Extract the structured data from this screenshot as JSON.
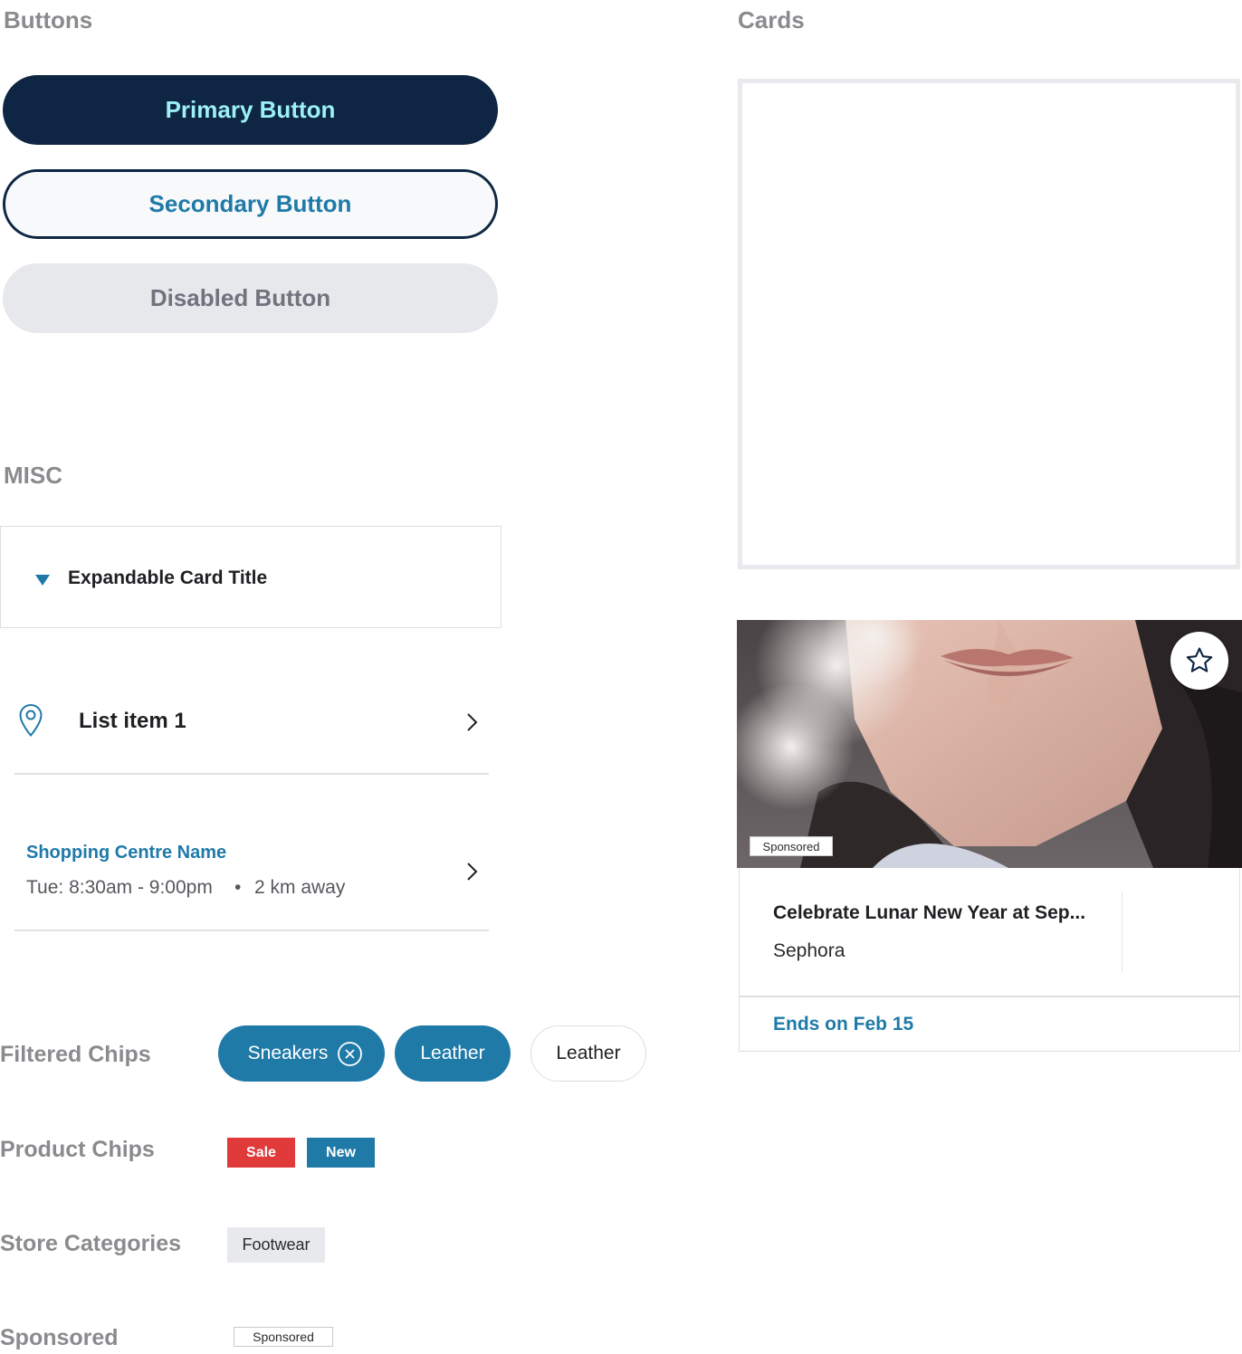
{
  "sections": {
    "buttons": "Buttons",
    "cards": "Cards",
    "misc": "MISC"
  },
  "buttons": {
    "primary": "Primary Button",
    "secondary": "Secondary Button",
    "disabled": "Disabled Button"
  },
  "expandable_card": {
    "title": "Expandable Card Title"
  },
  "list_item": {
    "label": "List item 1",
    "icon": "map-pin-icon"
  },
  "shopping_centre": {
    "name": "Shopping Centre Name",
    "hours": "Tue: 8:30am - 9:00pm",
    "separator": "•",
    "distance": "2 km away"
  },
  "filtered_chips": {
    "label": "Filtered Chips",
    "chips": [
      "Sneakers",
      "Leather",
      "Leather"
    ]
  },
  "product_chips": {
    "label": "Product Chips",
    "sale": "Sale",
    "new": "New"
  },
  "store_categories": {
    "label": "Store Categories",
    "chip": "Footwear"
  },
  "sponsored": {
    "label": "Sponsored",
    "badge": "Sponsored"
  },
  "promo_card": {
    "badge": "Sponsored",
    "title": "Celebrate Lunar New Year at Sep...",
    "store": "Sephora",
    "ends": "Ends on Feb 15"
  },
  "colors": {
    "primary_navy": "#0e2643",
    "accent_blue": "#1f7aa8",
    "primary_text_cyan": "#9cf0f6",
    "sale_red": "#e03a3a",
    "new_blue": "#1f7aa8",
    "muted_label": "#8a8b8e"
  }
}
